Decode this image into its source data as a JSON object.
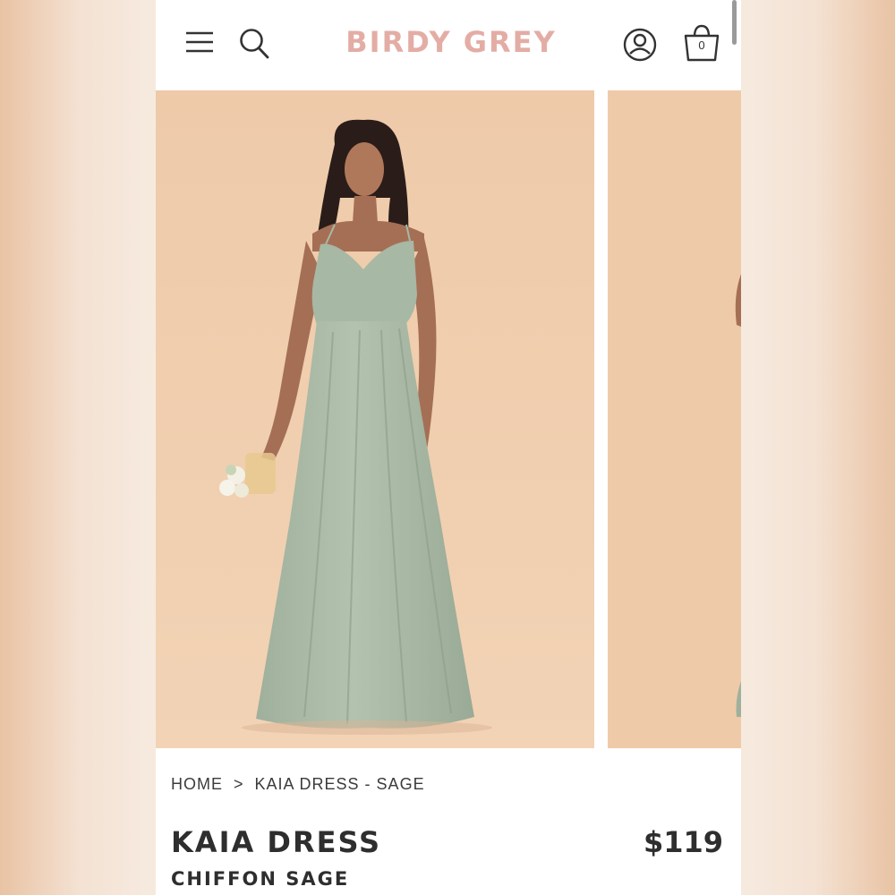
{
  "header": {
    "brand": "BIRDY GREY",
    "bag_count": "0",
    "brand_color": "#e3ada5",
    "icons": [
      "menu-icon",
      "search-icon",
      "account-icon",
      "shopping-bag-icon"
    ]
  },
  "gallery": {
    "background_color": "#eec9a7",
    "dress_color": "#a9b9a6"
  },
  "breadcrumb": {
    "home": "HOME",
    "separator": ">",
    "current": "KAIA DRESS - SAGE"
  },
  "product": {
    "name": "KAIA DRESS",
    "price": "$119",
    "variant": "CHIFFON SAGE"
  }
}
